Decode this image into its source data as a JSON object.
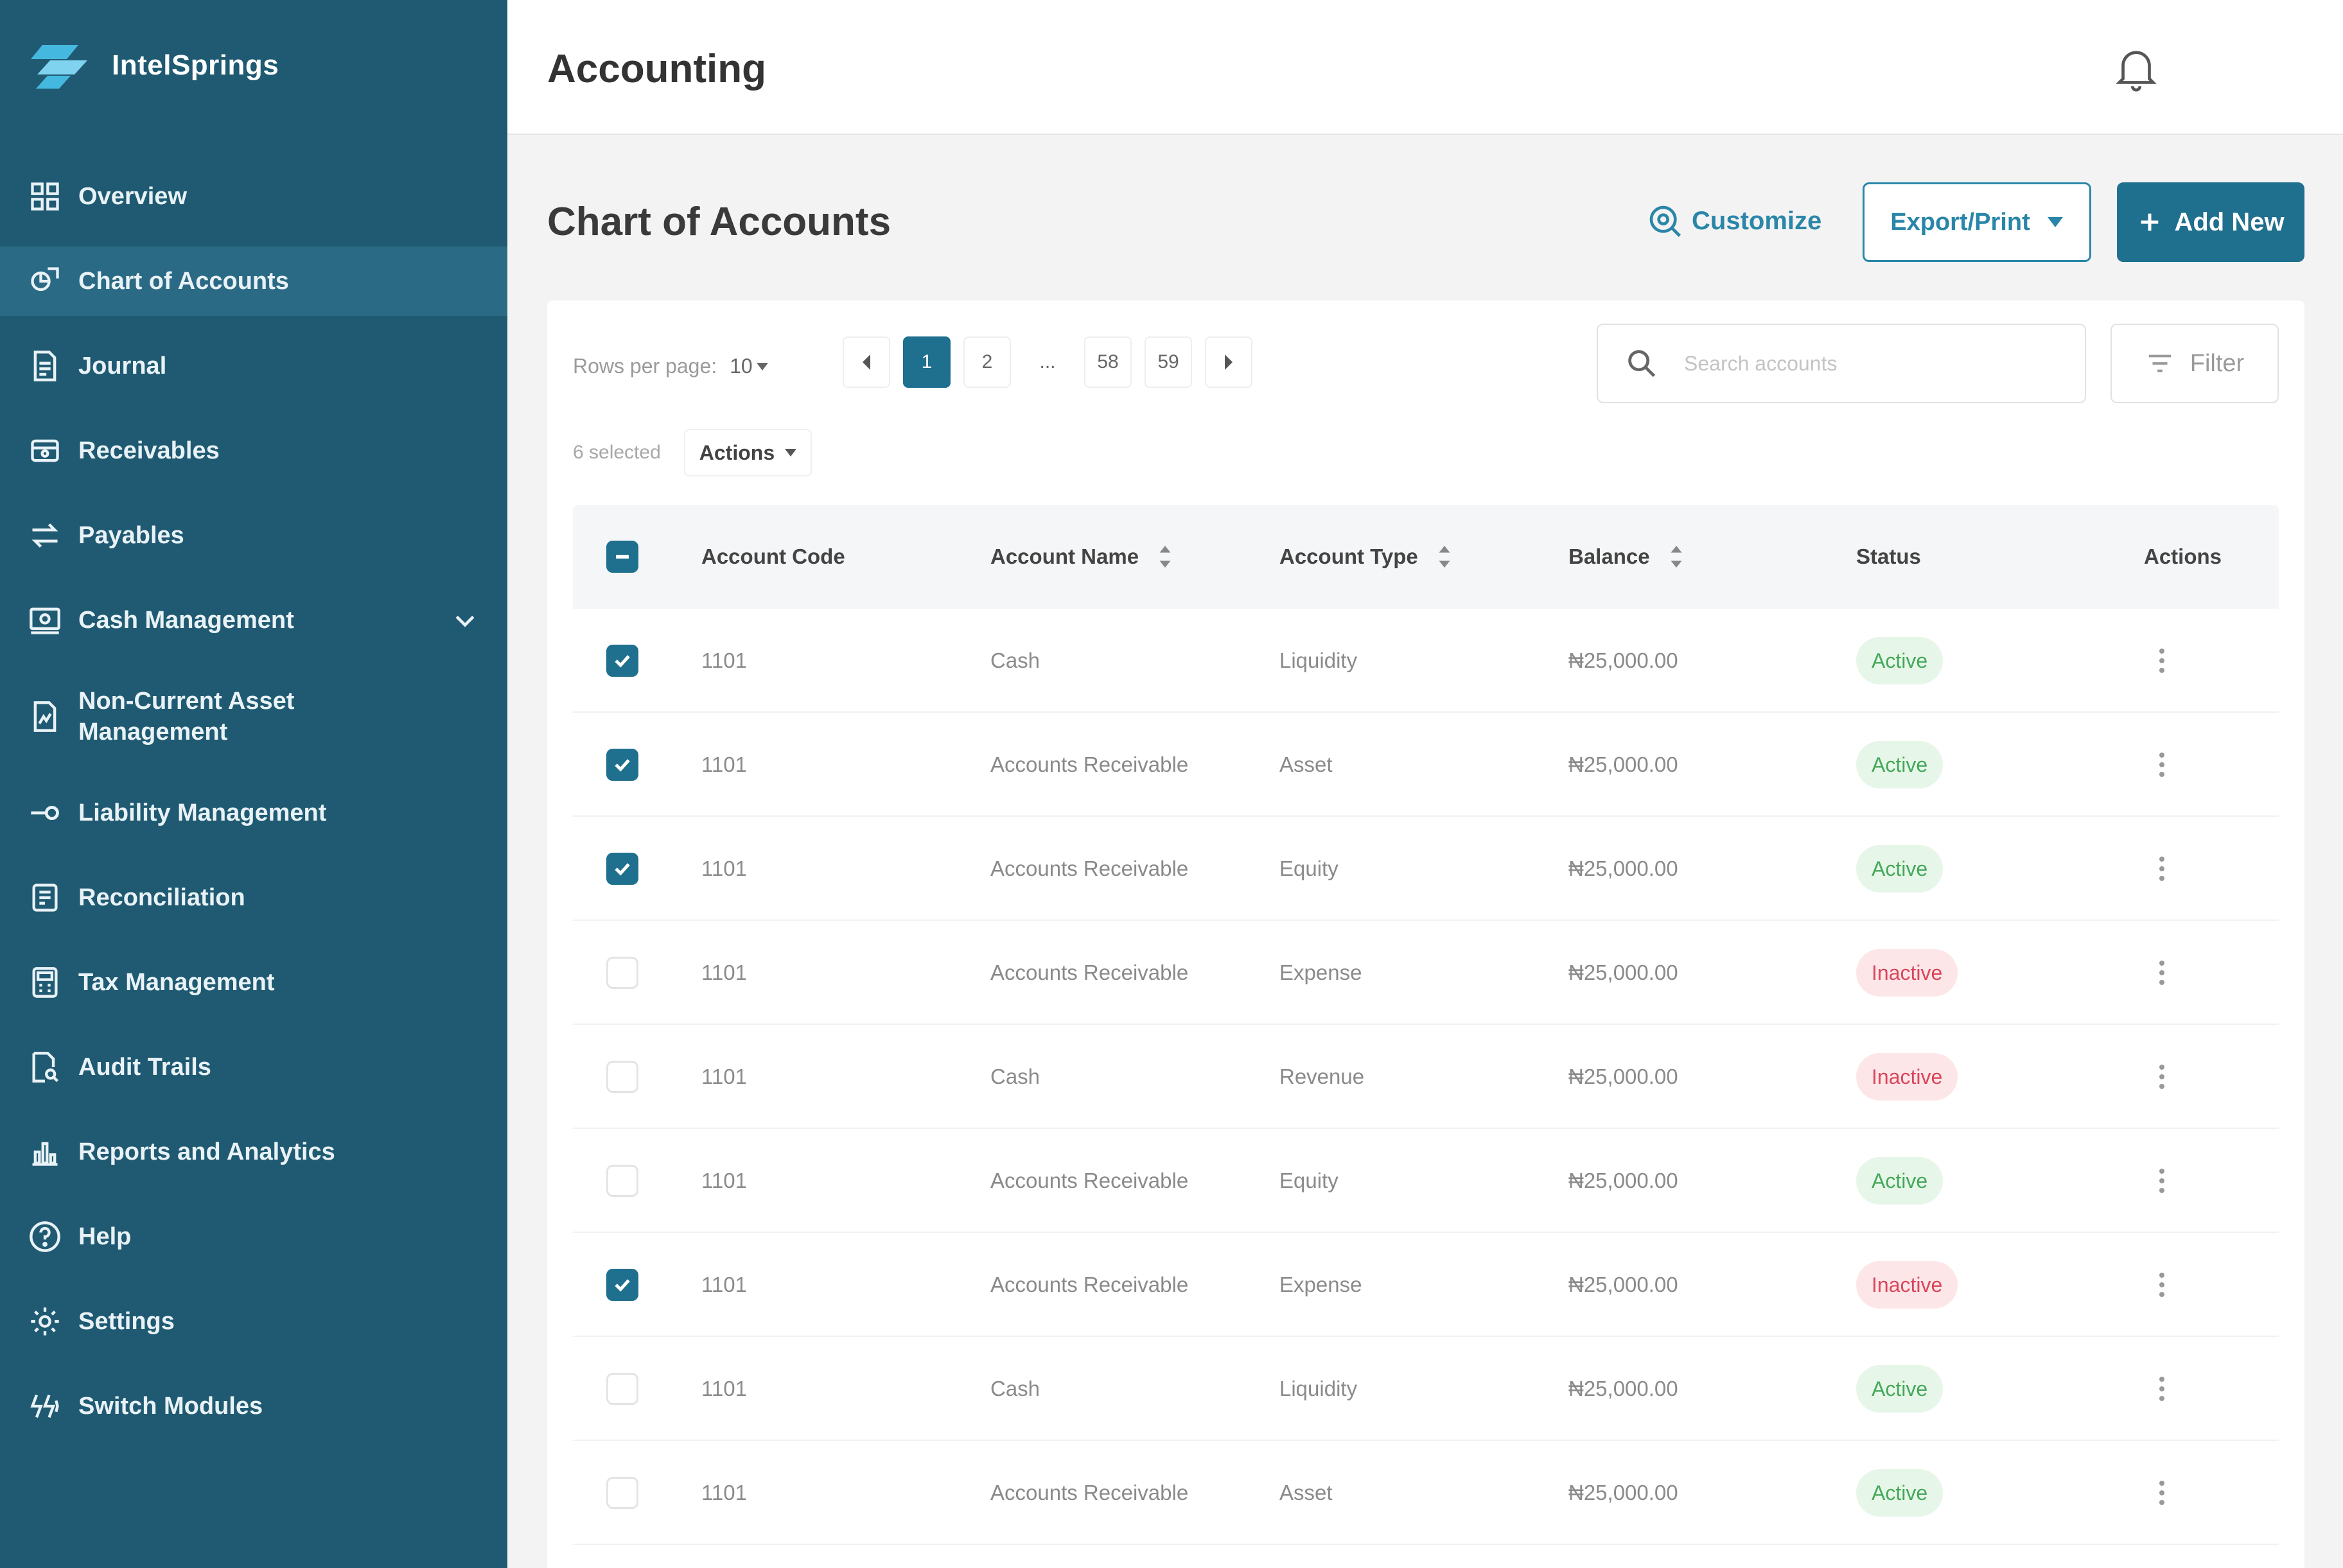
{
  "app": {
    "brand_name": "IntelSprings",
    "header_title": "Accounting"
  },
  "colors": {
    "sidebar_bg": "#1f5a72",
    "sidebar_active": "#2a6a84",
    "accent": "#1f6f8e",
    "link": "#2a86a8",
    "active_badge_bg": "#e6f6e8",
    "active_badge_text": "#45a85a",
    "inactive_badge_bg": "#fde6e8",
    "inactive_badge_text": "#d9455a"
  },
  "sidebar": {
    "items": [
      {
        "label": "Overview",
        "icon": "grid-icon"
      },
      {
        "label": "Chart of Accounts",
        "icon": "chart-accounts-icon",
        "active": true
      },
      {
        "label": "Journal",
        "icon": "journal-icon"
      },
      {
        "label": "Receivables",
        "icon": "receivables-icon"
      },
      {
        "label": "Payables",
        "icon": "payables-icon"
      },
      {
        "label": "Cash Management",
        "icon": "cash-icon",
        "expandable": true
      },
      {
        "label": "Non-Current Asset Management",
        "icon": "asset-icon"
      },
      {
        "label": "Liability Management",
        "icon": "liability-icon"
      },
      {
        "label": "Reconciliation",
        "icon": "reconciliation-icon"
      },
      {
        "label": "Tax Management",
        "icon": "tax-icon"
      },
      {
        "label": "Audit Trails",
        "icon": "audit-icon"
      },
      {
        "label": "Reports and Analytics",
        "icon": "reports-icon"
      },
      {
        "label": "Help",
        "icon": "help-icon"
      },
      {
        "label": "Settings",
        "icon": "settings-icon"
      },
      {
        "label": "Switch Modules",
        "icon": "switch-icon"
      }
    ]
  },
  "page": {
    "title": "Chart of Accounts",
    "customize_label": "Customize",
    "export_label": "Export/Print",
    "add_new_label": "Add New"
  },
  "toolbar": {
    "rows_per_page_label": "Rows per page:",
    "rows_per_page_value": "10",
    "pages": [
      "1",
      "2",
      "...",
      "58",
      "59"
    ],
    "current_page": "1",
    "search_placeholder": "Search accounts",
    "filter_label": "Filter",
    "selected_text": "6 selected",
    "actions_label": "Actions"
  },
  "table": {
    "headers": {
      "code": "Account Code",
      "name": "Account Name",
      "type": "Account Type",
      "balance": "Balance",
      "status": "Status",
      "actions": "Actions"
    },
    "rows": [
      {
        "checked": true,
        "code": "1101",
        "name": "Cash",
        "type": "Liquidity",
        "balance": "₦25,000.00",
        "status": "Active"
      },
      {
        "checked": true,
        "code": "1101",
        "name": "Accounts Receivable",
        "type": "Asset",
        "balance": "₦25,000.00",
        "status": "Active"
      },
      {
        "checked": true,
        "code": "1101",
        "name": "Accounts Receivable",
        "type": "Equity",
        "balance": "₦25,000.00",
        "status": "Active"
      },
      {
        "checked": false,
        "code": "1101",
        "name": "Accounts Receivable",
        "type": "Expense",
        "balance": "₦25,000.00",
        "status": "Inactive"
      },
      {
        "checked": false,
        "code": "1101",
        "name": "Cash",
        "type": "Revenue",
        "balance": "₦25,000.00",
        "status": "Inactive"
      },
      {
        "checked": false,
        "code": "1101",
        "name": "Accounts Receivable",
        "type": "Equity",
        "balance": "₦25,000.00",
        "status": "Active"
      },
      {
        "checked": true,
        "code": "1101",
        "name": "Accounts Receivable",
        "type": "Expense",
        "balance": "₦25,000.00",
        "status": "Inactive"
      },
      {
        "checked": false,
        "code": "1101",
        "name": "Cash",
        "type": "Liquidity",
        "balance": "₦25,000.00",
        "status": "Active"
      },
      {
        "checked": false,
        "code": "1101",
        "name": "Accounts Receivable",
        "type": "Asset",
        "balance": "₦25,000.00",
        "status": "Active"
      }
    ]
  }
}
